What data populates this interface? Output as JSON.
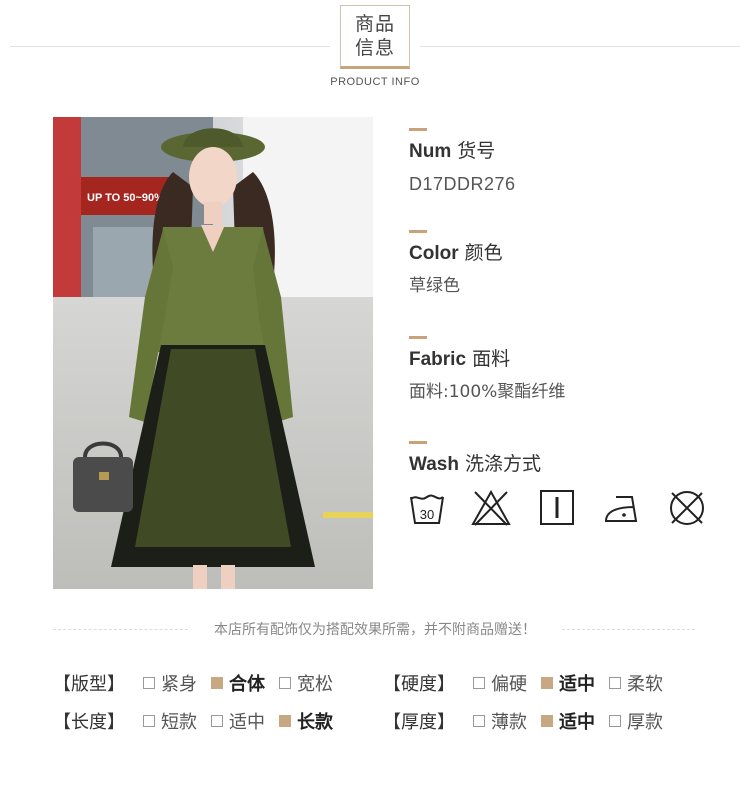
{
  "header": {
    "title_line1": "商品",
    "title_line2": "信息",
    "subtitle": "PRODUCT INFO"
  },
  "photo": {
    "shop_sign": "UP TO 50~90% OFF"
  },
  "info": {
    "num": {
      "en": "Num",
      "zh": "货号",
      "value": "D17DDR276"
    },
    "color": {
      "en": "Color",
      "zh": "颜色",
      "value": "草绿色"
    },
    "fabric": {
      "en": "Fabric",
      "zh": "面料",
      "value": "面料:100%聚酯纤维"
    },
    "wash": {
      "en": "Wash",
      "zh": "洗涤方式",
      "icons": [
        "wash-30-icon",
        "no-bleach-icon",
        "hang-dry-icon",
        "iron-low-icon",
        "no-dry-clean-icon"
      ],
      "temp": "30"
    }
  },
  "notice": "本店所有配饰仅为搭配效果所需，并不附商品赠送！",
  "attributes": {
    "fit": {
      "label": "【版型】",
      "options": [
        "紧身",
        "合体",
        "宽松"
      ],
      "selected": 1
    },
    "hardness": {
      "label": "【硬度】",
      "options": [
        "偏硬",
        "适中",
        "柔软"
      ],
      "selected": 1
    },
    "length": {
      "label": "【长度】",
      "options": [
        "短款",
        "适中",
        "长款"
      ],
      "selected": 2
    },
    "thickness": {
      "label": "【厚度】",
      "options": [
        "薄款",
        "适中",
        "厚款"
      ],
      "selected": 1
    }
  },
  "colors": {
    "accent": "#c9a27a",
    "checked": "#c8a882",
    "sweater": "#6c7c3e",
    "skirt": "#1c1f18"
  }
}
